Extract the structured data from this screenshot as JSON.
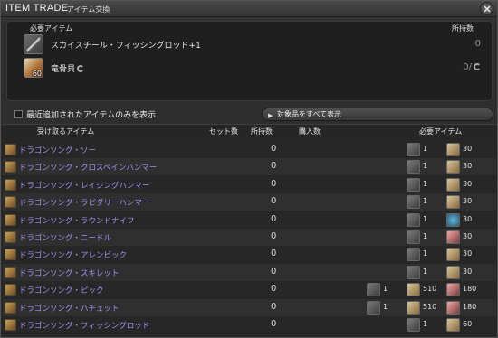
{
  "window": {
    "title": "ITEM TRADE",
    "subtitle": "アイテム交換"
  },
  "required": {
    "header_item": "必要アイテム",
    "header_have": "所持数",
    "items": [
      {
        "name": "スカイスチール・フィッシングロッド+1",
        "have": "0",
        "icon": "fishing-rod-icon",
        "qty": ""
      },
      {
        "name": "竜骨貝",
        "have": "0/",
        "icon": "dragon-bone-shell-icon",
        "qty": "60"
      }
    ]
  },
  "filter": {
    "checkbox_label": "最近追加されたアイテムのみを表示",
    "show_all_label": "対象品をすべて表示"
  },
  "columns": {
    "receive": "受け取るアイテム",
    "sets": "セット数",
    "have": "所持数",
    "buy": "購入数",
    "required": "必要アイテム"
  },
  "rows": [
    {
      "name": "ドラゴンソング・ソー",
      "have": "0",
      "mats": [
        {
          "num": "1"
        },
        {
          "num": "30"
        }
      ]
    },
    {
      "name": "ドラゴンソング・クロスペインハンマー",
      "have": "0",
      "mats": [
        {
          "num": "1"
        },
        {
          "num": "30"
        }
      ]
    },
    {
      "name": "ドラゴンソング・レイジングハンマー",
      "have": "0",
      "mats": [
        {
          "num": "1"
        },
        {
          "num": "30"
        }
      ]
    },
    {
      "name": "ドラゴンソング・ラピダリーハンマー",
      "have": "0",
      "mats": [
        {
          "num": "1"
        },
        {
          "num": "30"
        }
      ]
    },
    {
      "name": "ドラゴンソング・ラウンドナイフ",
      "have": "0",
      "mats": [
        {
          "num": "1"
        },
        {
          "num": "30"
        }
      ]
    },
    {
      "name": "ドラゴンソング・ニードル",
      "have": "0",
      "mats": [
        {
          "num": "1"
        },
        {
          "num": "30"
        }
      ]
    },
    {
      "name": "ドラゴンソング・アレンビック",
      "have": "0",
      "mats": [
        {
          "num": "1"
        },
        {
          "num": "30"
        }
      ]
    },
    {
      "name": "ドラゴンソング・スキレット",
      "have": "0",
      "mats": [
        {
          "num": "1"
        },
        {
          "num": "30"
        }
      ]
    },
    {
      "name": "ドラゴンソング・ピック",
      "have": "0",
      "mats": [
        {
          "num": "1"
        },
        {
          "num": "510"
        },
        {
          "num": "180"
        }
      ]
    },
    {
      "name": "ドラゴンソング・ハチェット",
      "have": "0",
      "mats": [
        {
          "num": "1"
        },
        {
          "num": "510"
        },
        {
          "num": "180"
        }
      ]
    },
    {
      "name": "ドラゴンソング・フィッシングロッド",
      "have": "0",
      "mats": [
        {
          "num": "1"
        },
        {
          "num": "60"
        }
      ]
    }
  ],
  "colors": {
    "item_name": "#a38df0",
    "background": "#2b2b2b"
  }
}
